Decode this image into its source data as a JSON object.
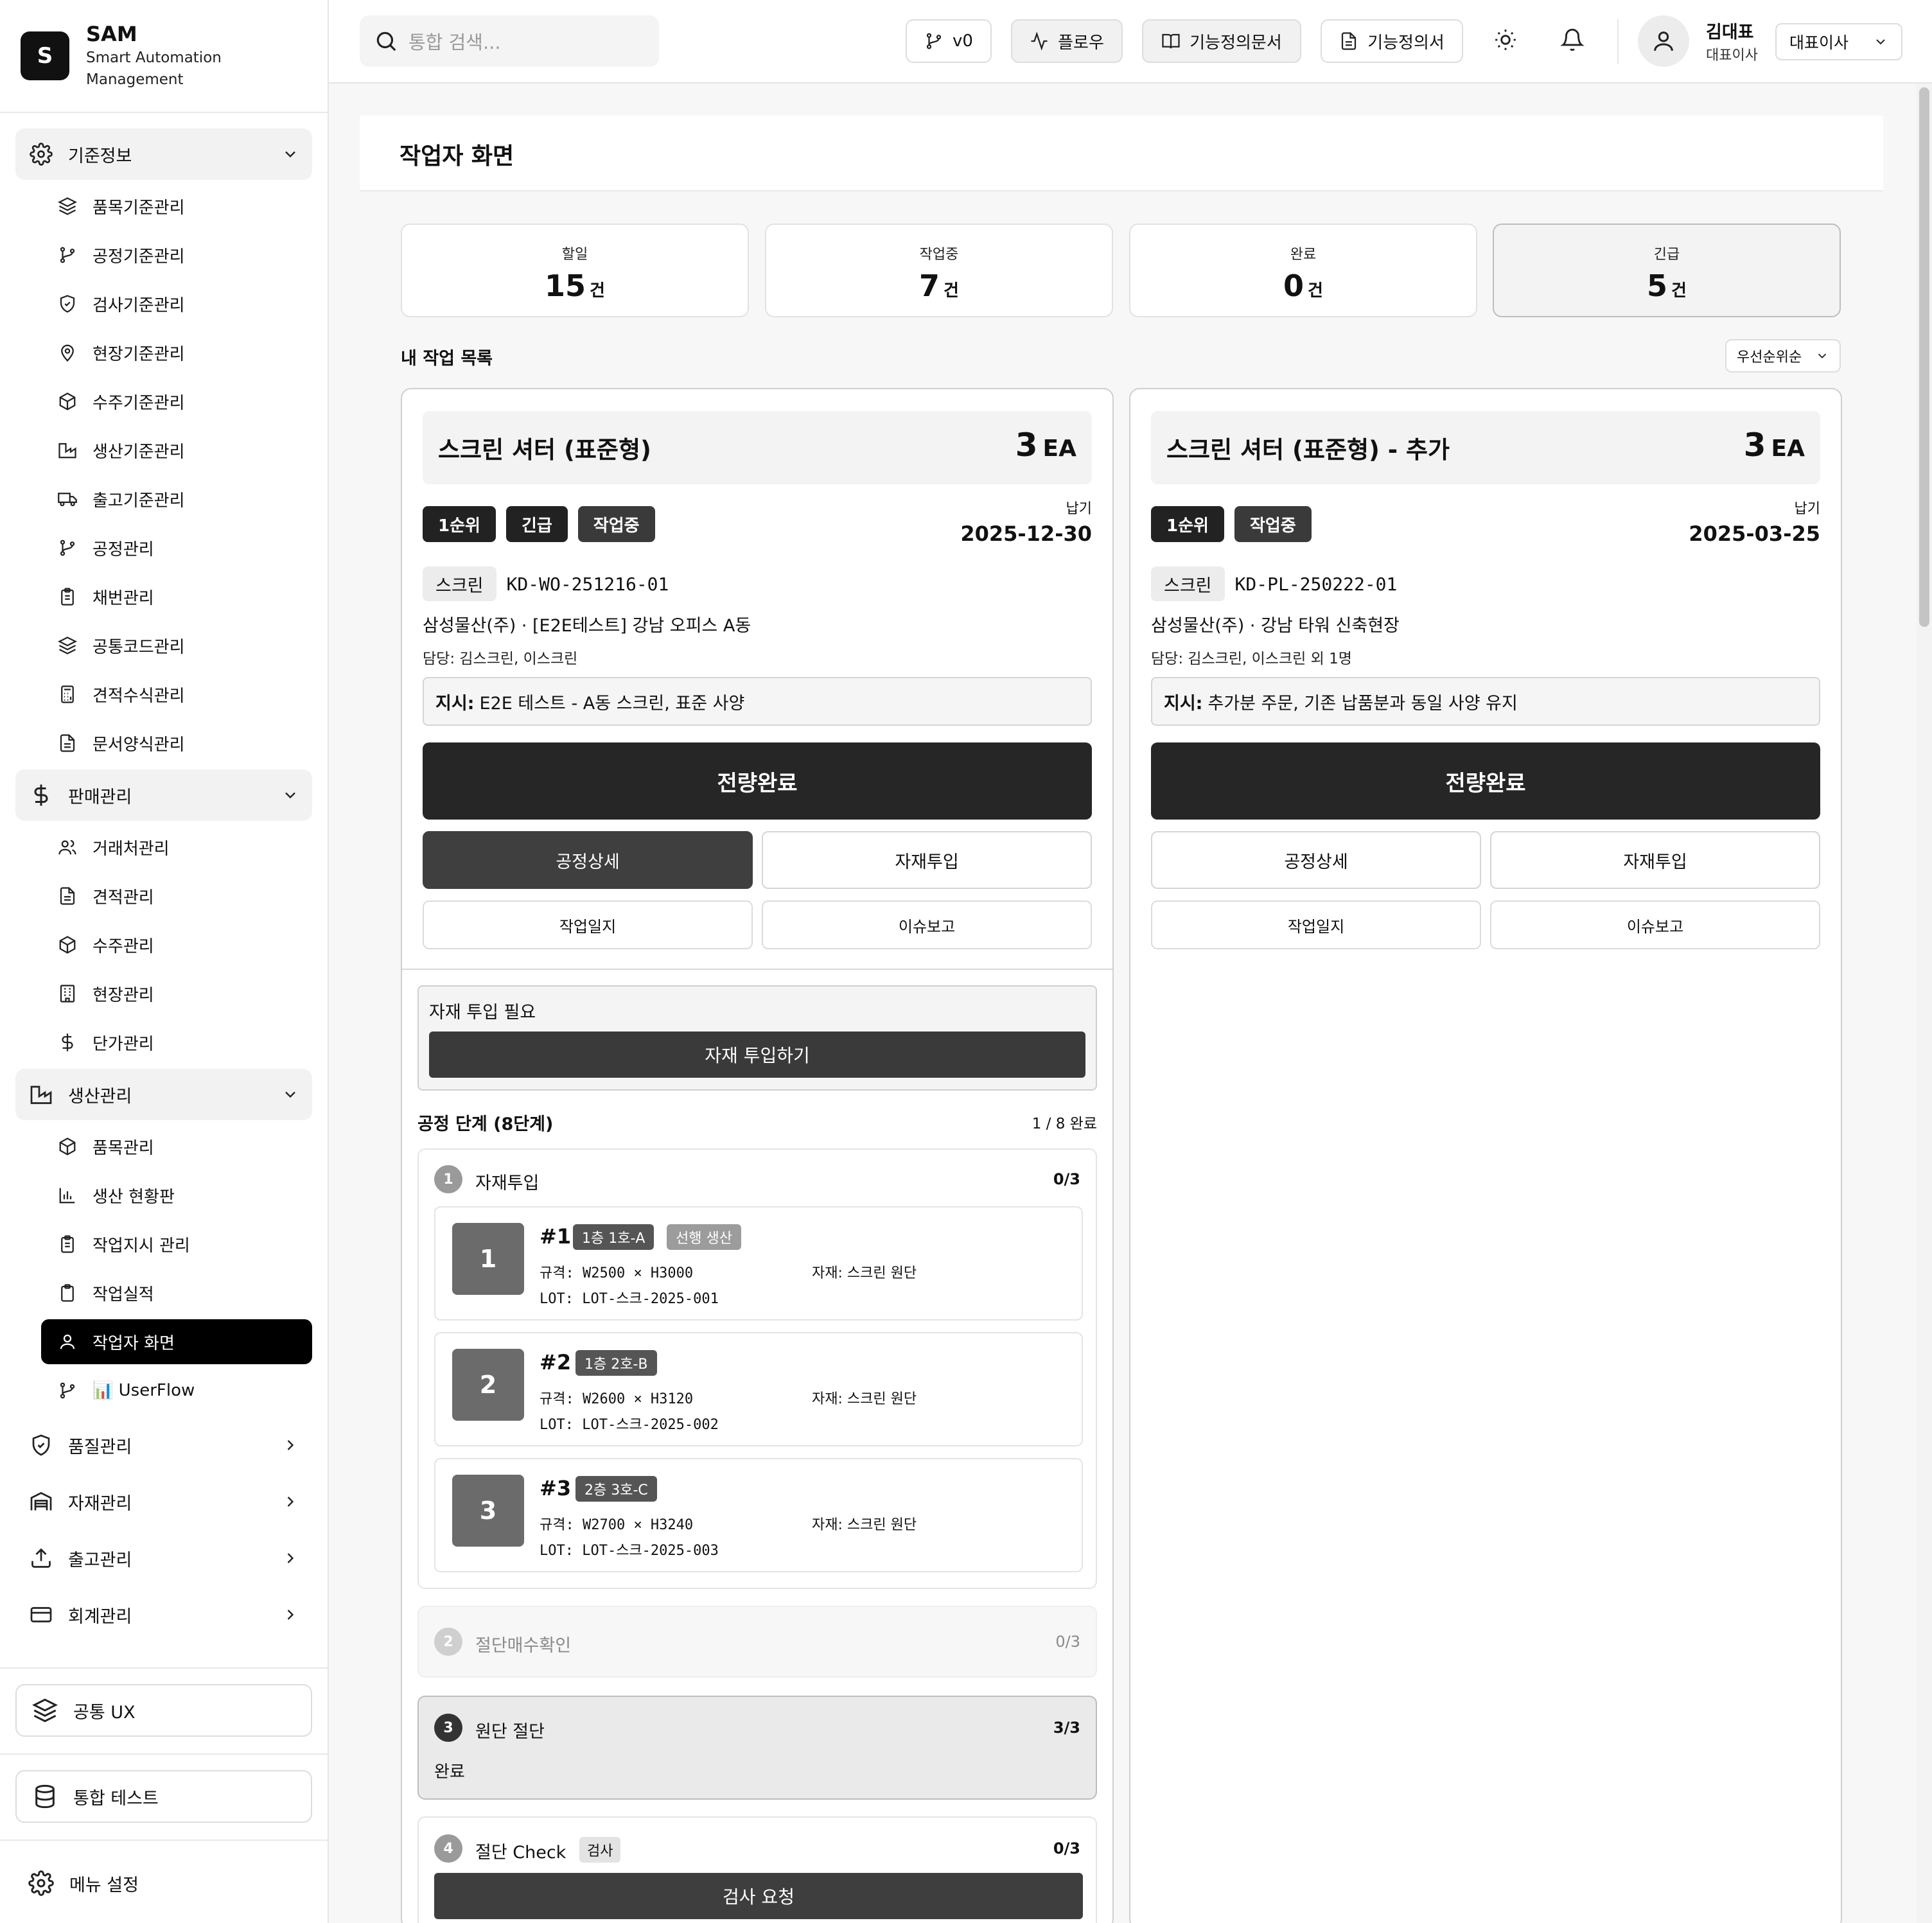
{
  "brand": {
    "logo": "S",
    "name": "SAM",
    "sub1": "Smart Automation",
    "sub2": "Management"
  },
  "sidebar": {
    "group1": {
      "label": "기준정보",
      "icon": "gear-icon"
    },
    "items1": [
      "품목기준관리",
      "공정기준관리",
      "검사기준관리",
      "현장기준관리",
      "수주기준관리",
      "생산기준관리",
      "출고기준관리",
      "공정관리",
      "채번관리",
      "공통코드관리",
      "견적수식관리",
      "문서양식관리"
    ],
    "group2": {
      "label": "판매관리",
      "icon": "dollar-icon"
    },
    "items2": [
      "거래처관리",
      "견적관리",
      "수주관리",
      "현장관리",
      "단가관리"
    ],
    "group3": {
      "label": "생산관리",
      "icon": "factory-icon"
    },
    "items3": [
      "품목관리",
      "생산 현황판",
      "작업지시 관리",
      "작업실적",
      "작업자 화면",
      "📊 UserFlow"
    ],
    "active": "작업자 화면",
    "closed": [
      "품질관리",
      "자재관리",
      "출고관리",
      "회계관리"
    ],
    "common_ux": "공통 UX",
    "integration_test": "통합 테스트",
    "menu_settings": "메뉴 설정"
  },
  "header": {
    "search_placeholder": "통합 검색...",
    "version": "v0",
    "flow": "플로우",
    "spec_doc": "기능정의문서",
    "spec": "기능정의서",
    "user_name": "김대표",
    "user_role": "대표이사",
    "role_select": "대표이사"
  },
  "page": {
    "title": "작업자 화면",
    "stats": [
      {
        "label": "할일",
        "value": "15",
        "unit": "건"
      },
      {
        "label": "작업중",
        "value": "7",
        "unit": "건"
      },
      {
        "label": "완료",
        "value": "0",
        "unit": "건"
      },
      {
        "label": "긴급",
        "value": "5",
        "unit": "건"
      }
    ],
    "section_title": "내 작업 목록",
    "sort": "우선순위순"
  },
  "cards": [
    {
      "title": "스크린 셔터 (표준형)",
      "qty": "3",
      "qty_unit": "EA",
      "badges": [
        "1순위",
        "긴급",
        "작업중"
      ],
      "due_label": "납기",
      "due": "2025-12-30",
      "tag": "스크린",
      "code": "KD-WO-251216-01",
      "site": "삼성물산(주) · [E2E테스트] 강남 오피스 A동",
      "manager": "담당: 김스크린, 이스크린",
      "inst_label": "지시:",
      "inst": "E2E 테스트 - A동 스크린, 표준 사양",
      "complete": "전량완료",
      "btn_process": "공정상세",
      "btn_material": "자재투입",
      "btn_log": "작업일지",
      "btn_issue": "이슈보고",
      "need_label": "자재 투입 필요",
      "need_btn": "자재 투입하기",
      "steps_title": "공정 단계 (8단계)",
      "steps_count": "1 / 8 완료",
      "step1": {
        "num": "1",
        "name": "자재투입",
        "count": "0/3"
      },
      "units": [
        {
          "box": "1",
          "hash": "#1",
          "loc": "1층 1호-A",
          "pre": "선행 생산",
          "spec": "규격: W2500 × H3000",
          "lot": "LOT: LOT-스크-2025-001",
          "mat": "자재: 스크린 원단"
        },
        {
          "box": "2",
          "hash": "#2",
          "loc": "1층 2호-B",
          "spec": "규격: W2600 × H3120",
          "lot": "LOT: LOT-스크-2025-002",
          "mat": "자재: 스크린 원단"
        },
        {
          "box": "3",
          "hash": "#3",
          "loc": "2층 3호-C",
          "spec": "규격: W2700 × H3240",
          "lot": "LOT: LOT-스크-2025-003",
          "mat": "자재: 스크린 원단"
        }
      ],
      "step2": {
        "num": "2",
        "name": "절단매수확인",
        "count": "0/3"
      },
      "step3": {
        "num": "3",
        "name": "원단 절단",
        "count": "3/3",
        "status": "완료"
      },
      "step4": {
        "num": "4",
        "name": "절단 Check",
        "tag": "검사",
        "count": "0/3",
        "btn": "검사 요청"
      }
    },
    {
      "title": "스크린 셔터 (표준형) - 추가",
      "qty": "3",
      "qty_unit": "EA",
      "badges": [
        "1순위",
        "작업중"
      ],
      "due_label": "납기",
      "due": "2025-03-25",
      "tag": "스크린",
      "code": "KD-PL-250222-01",
      "site": "삼성물산(주) · 강남 타워 신축현장",
      "manager": "담당: 김스크린, 이스크린 외 1명",
      "inst_label": "지시:",
      "inst": "추가분 주문, 기존 납품분과 동일 사양 유지",
      "complete": "전량완료",
      "btn_process": "공정상세",
      "btn_material": "자재투입",
      "btn_log": "작업일지",
      "btn_issue": "이슈보고"
    }
  ]
}
